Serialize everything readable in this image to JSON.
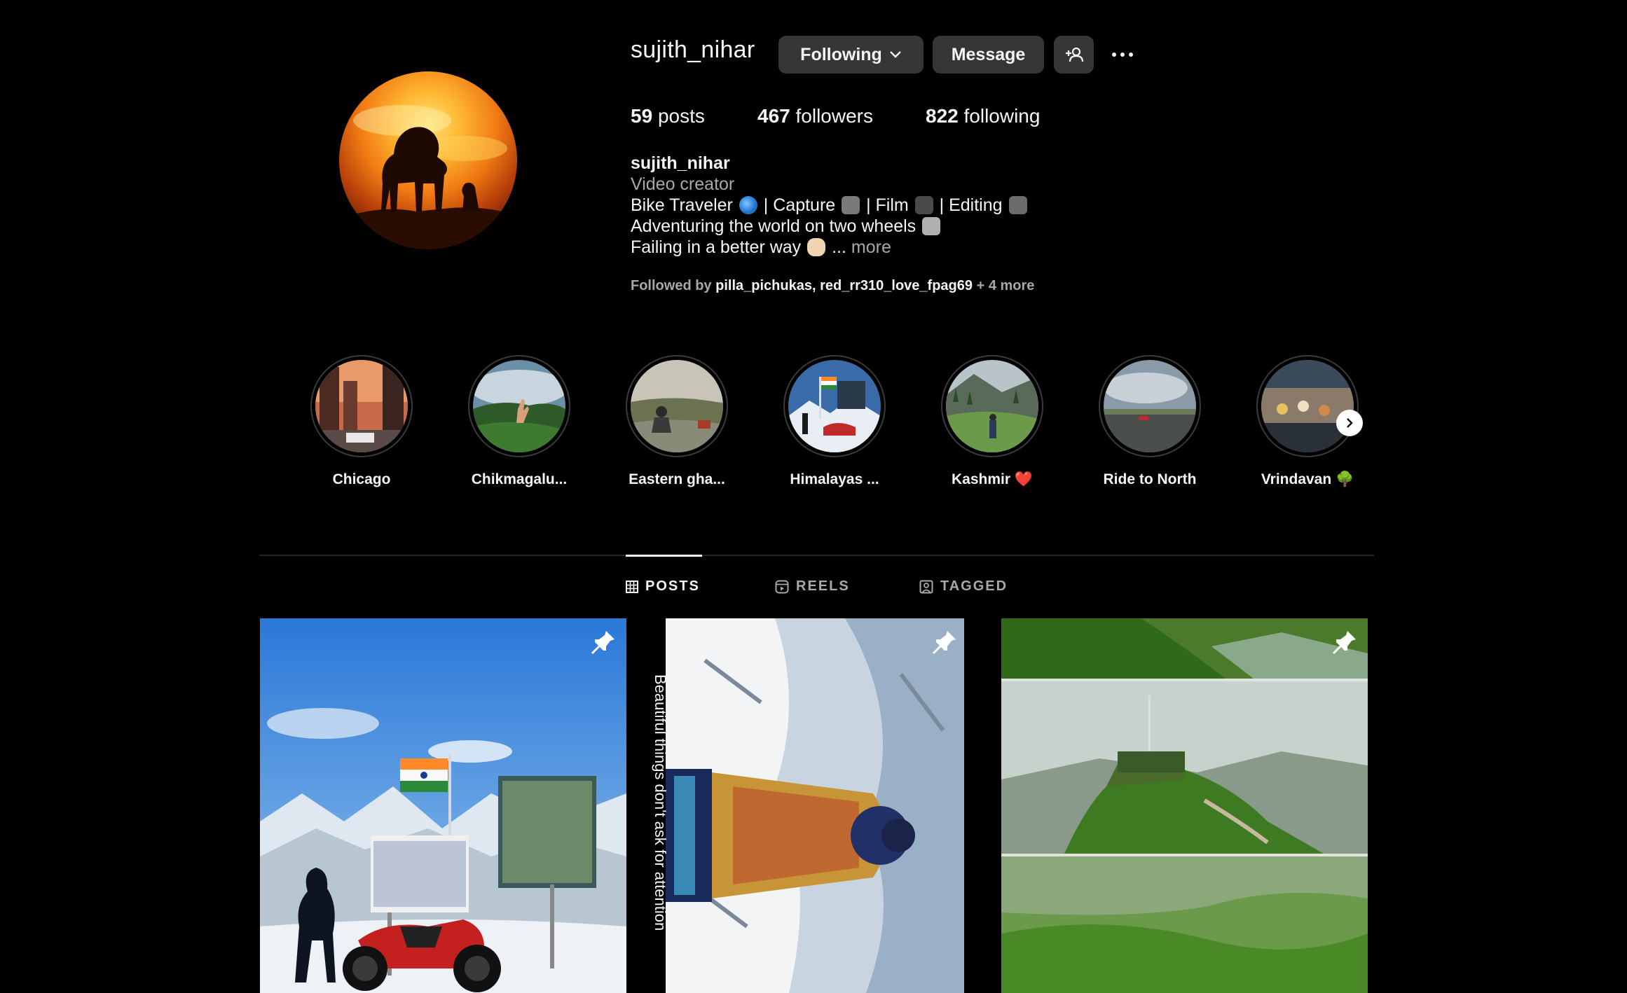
{
  "profile": {
    "username": "sujith_nihar",
    "following_button": "Following",
    "message_button": "Message",
    "stats": {
      "posts_count": "59",
      "posts_label": "posts",
      "followers_count": "467",
      "followers_label": "followers",
      "following_count": "822",
      "following_label": "following"
    },
    "bio": {
      "name": "sujith_nihar",
      "category": "Video creator",
      "line1_a": "Bike Traveler",
      "line1_b": "| Capture",
      "line1_c": "| Film",
      "line1_d": "| Editing",
      "line2": "Adventuring the world on two wheels",
      "line3": "Failing in a better way",
      "ellipsis": "...",
      "more": "more"
    },
    "followed_by": {
      "prefix": "Followed by",
      "account1": "pilla_pichukas",
      "separator": ",",
      "account2": "red_rr310_love_fpag69",
      "suffix": "+ 4 more"
    }
  },
  "highlights": [
    {
      "label": "Chicago",
      "icon": "city-street"
    },
    {
      "label": "Chikmagalu...",
      "icon": "hand-mountains"
    },
    {
      "label": "Eastern gha...",
      "icon": "person-sitting-hills"
    },
    {
      "label": "Himalayas ...",
      "icon": "bike-signboard"
    },
    {
      "label": "Kashmir ❤️",
      "icon": "valley-person"
    },
    {
      "label": "Ride to North",
      "icon": "road-sky"
    },
    {
      "label": "Vrindavan 🌳",
      "icon": "temple-crowd"
    }
  ],
  "tabs": {
    "posts": "POSTS",
    "reels": "REELS",
    "tagged": "TAGGED"
  },
  "posts": [
    {
      "icon": "pin-icon",
      "description_icon": "rider-with-flag"
    },
    {
      "icon": "pin-icon",
      "overlay_text": "Beautiful things don't ask for attention"
    },
    {
      "icon": "pin-icon",
      "description_icon": "green-fort-hill"
    }
  ],
  "colors": {
    "background": "#000000",
    "button": "#363636",
    "secondary_text": "#a8a8a8",
    "primary_text": "#f5f5f5"
  }
}
